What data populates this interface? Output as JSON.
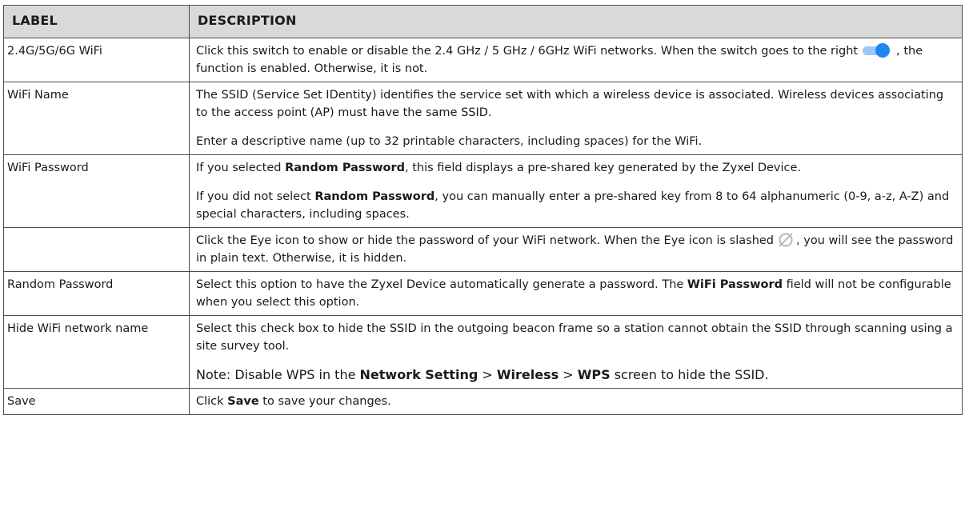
{
  "header": {
    "label": "LABEL",
    "description": "DESCRIPTION"
  },
  "rows": [
    {
      "label": "2.4G/5G/6G WiFi",
      "desc_before_icon": "Click this switch to enable or disable the 2.4 GHz / 5 GHz / 6GHz WiFi networks. When the switch goes to the right",
      "icon": "toggle-on-icon",
      "desc_after_icon": ", the function is enabled. Otherwise, it is not."
    },
    {
      "label": "WiFi Name",
      "paragraphs": [
        "The SSID (Service Set IDentity) identifies the service set with which a wireless device is associated. Wireless devices associating to the access point (AP) must have the same SSID.",
        "Enter a descriptive name (up to 32 printable characters, including spaces) for the WiFi."
      ]
    },
    {
      "label": "WiFi Password",
      "p1_pre": "If you selected ",
      "p1_bold": "Random Password",
      "p1_post": ", this field displays a pre-shared key generated by the Zyxel Device.",
      "p2_pre": "If you did not select ",
      "p2_bold": "Random Password",
      "p2_post": ", you can manually enter a pre-shared key from 8 to 64 alphanumeric (0-9, a-z, A-Z) and special characters, including spaces."
    },
    {
      "label": "",
      "desc_before_icon": "Click the Eye icon to show or hide the password of your WiFi network. When the Eye icon is slashed",
      "icon": "eye-slashed-icon",
      "desc_after_icon": ", you will see the password in plain text. Otherwise, it is hidden."
    },
    {
      "label": "Random Password",
      "pre": "Select this option to have the Zyxel Device automatically generate a password. The ",
      "bold": "WiFi Password",
      "post": " field will not be configurable when you select this option."
    },
    {
      "label": "Hide WiFi network name",
      "p1": "Select this check box to hide the SSID in the outgoing beacon frame so a station cannot obtain the SSID through scanning using a site survey tool.",
      "note_pre": "Note: Disable WPS in the ",
      "note_b1": "Network Setting",
      "note_sep1": " > ",
      "note_b2": "Wireless",
      "note_sep2": " > ",
      "note_b3": "WPS",
      "note_post": " screen to hide the SSID."
    },
    {
      "label": "Save",
      "pre": "Click ",
      "bold": "Save",
      "post": " to save your changes."
    }
  ],
  "colors": {
    "header_bg": "#d9d9d9",
    "border": "#4d4d4d",
    "toggle_accent": "#1f86f0"
  }
}
